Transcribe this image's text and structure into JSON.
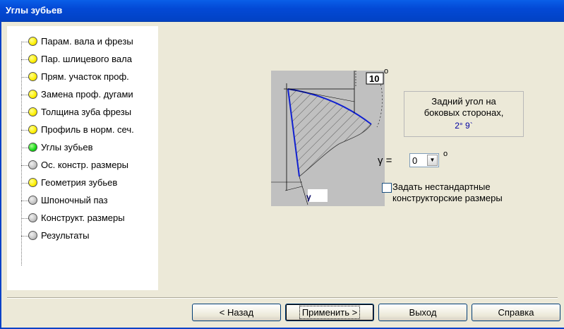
{
  "window": {
    "title": "Углы зубьев"
  },
  "tree": {
    "items": [
      {
        "label": "Парам. вала и фрезы",
        "status": "yellow"
      },
      {
        "label": "Пар. шлицевого вала",
        "status": "yellow"
      },
      {
        "label": "Прям. участок проф.",
        "status": "yellow"
      },
      {
        "label": "Замена проф. дугами",
        "status": "yellow"
      },
      {
        "label": "Толщина зуба фрезы",
        "status": "yellow"
      },
      {
        "label": "Профиль в норм. сеч.",
        "status": "yellow"
      },
      {
        "label": "Углы зубьев",
        "status": "green"
      },
      {
        "label": "Ос. констр. размеры",
        "status": "gray"
      },
      {
        "label": "Геометрия зубьев",
        "status": "yellow"
      },
      {
        "label": "Шпоночный паз",
        "status": "gray"
      },
      {
        "label": "Конструкт. размеры",
        "status": "gray"
      },
      {
        "label": "Результаты",
        "status": "gray"
      }
    ]
  },
  "diagram": {
    "angle_box": "10",
    "degree": "o",
    "gamma_symbol": "γ"
  },
  "info": {
    "line1": "Задний угол на",
    "line2": "боковых сторонах,",
    "value": "2° 9`"
  },
  "gamma": {
    "label": "γ =",
    "value": "0",
    "unit": "o"
  },
  "checkbox": {
    "line1": "Задать нестандартные",
    "line2": "конструкторские размеры",
    "checked": false
  },
  "buttons": {
    "back": "< Назад",
    "apply": "Применить >",
    "exit": "Выход",
    "help": "Справка"
  },
  "colors": {
    "titlebar": "#0349d6",
    "face": "#ece9d8",
    "yellow": "#ffef00",
    "green": "#14d814",
    "gray": "#c4c4c4",
    "curve": "#1020d0"
  }
}
